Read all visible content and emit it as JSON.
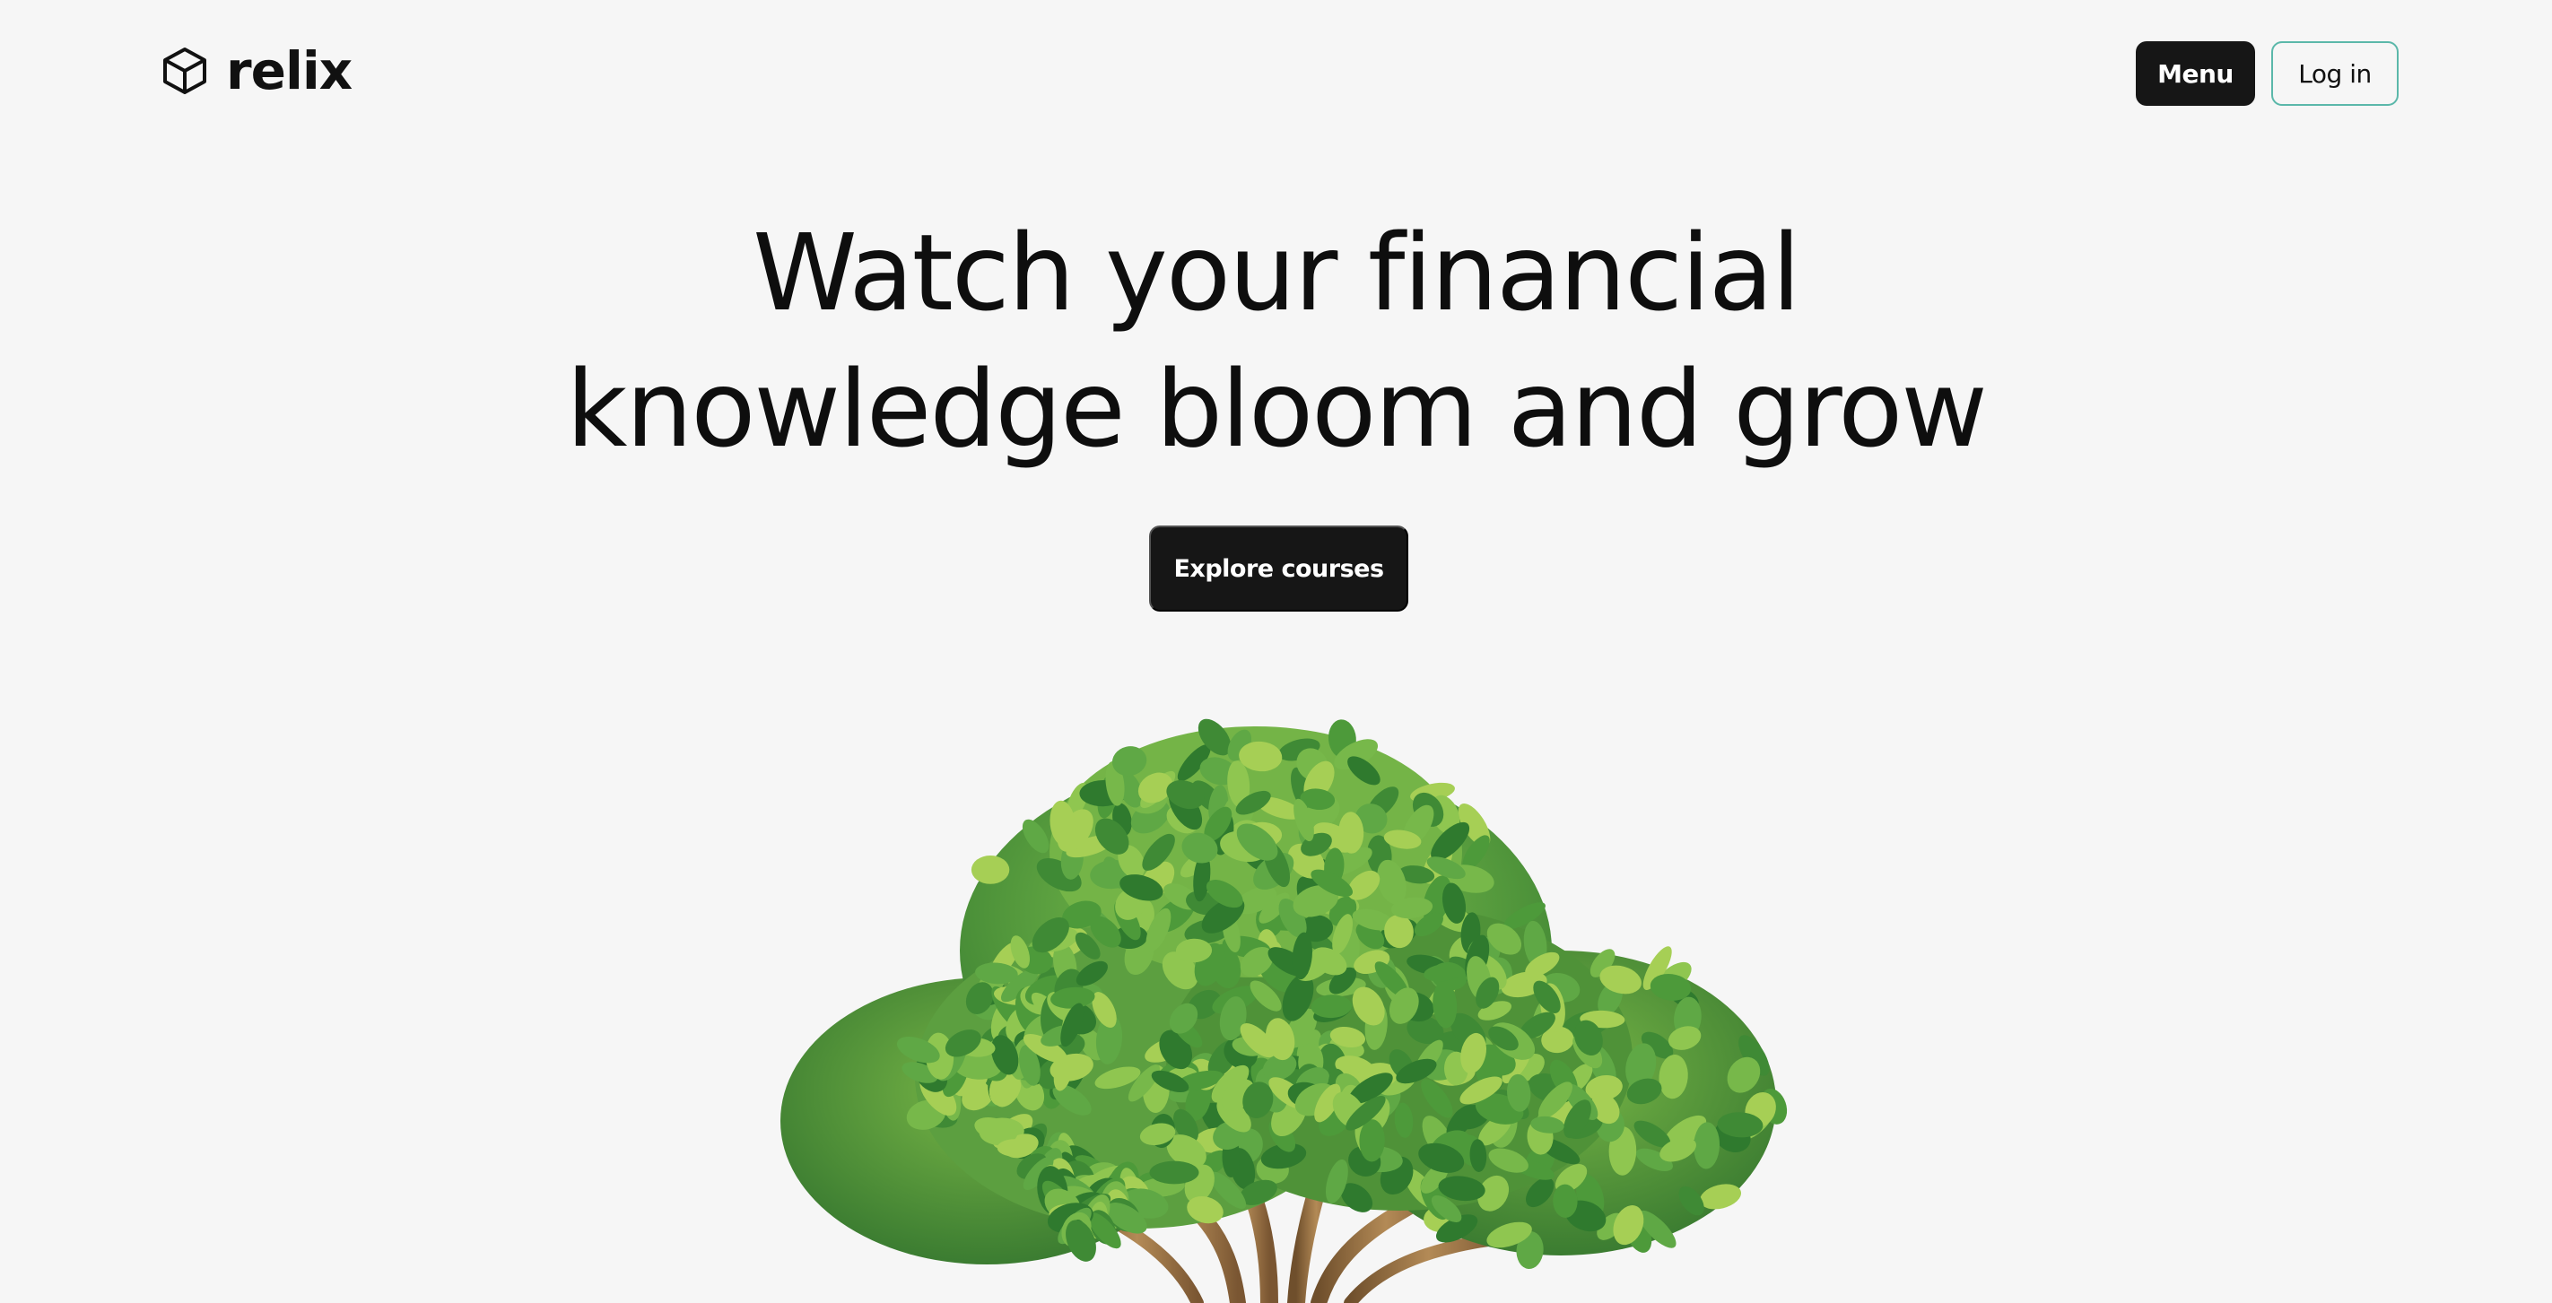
{
  "brand": {
    "name": "relix",
    "logo_icon": "cube-icon"
  },
  "nav": {
    "menu_label": "Menu",
    "login_label": "Log in"
  },
  "hero": {
    "title_line1": "Watch your financial",
    "title_line2": "knowledge bloom and grow",
    "cta_label": "Explore courses",
    "illustration": "tree-illustration"
  },
  "colors": {
    "background": "#f6f6f6",
    "dark_button": "#161616",
    "login_border": "#5bb8aa",
    "leaf_dark": "#3f8a35",
    "leaf_mid": "#5fa845",
    "leaf_light": "#a6cf55",
    "trunk": "#9b7446"
  }
}
